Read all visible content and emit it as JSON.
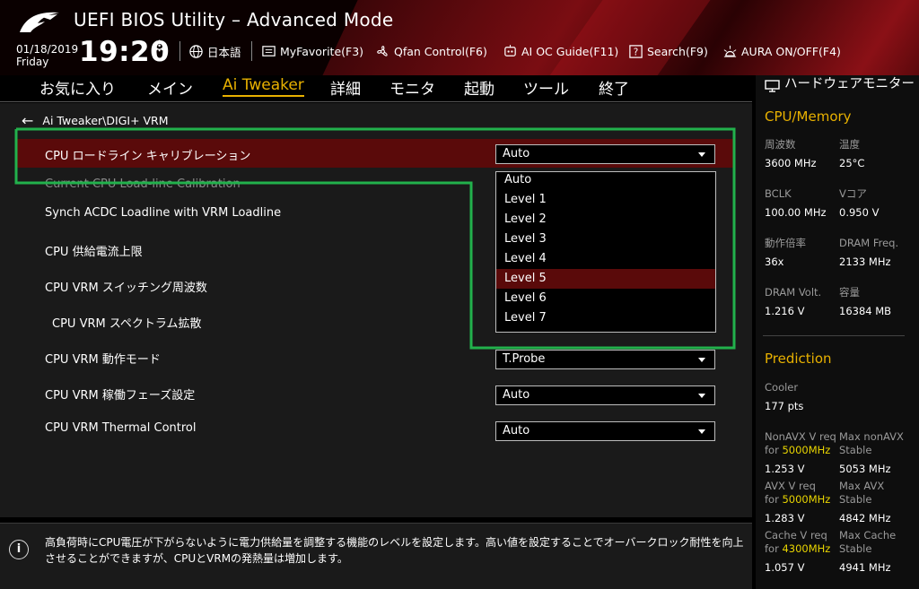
{
  "header": {
    "title": "UEFI BIOS Utility – Advanced Mode",
    "date": "01/18/2019",
    "day": "Friday",
    "time": "19:20",
    "tools": [
      {
        "label": "日本語",
        "icon": "globe-icon"
      },
      {
        "label": "MyFavorite(F3)",
        "icon": "favorite-icon"
      },
      {
        "label": "Qfan Control(F6)",
        "icon": "fan-icon"
      },
      {
        "label": "AI OC Guide(F11)",
        "icon": "ai-oc-guide-icon"
      },
      {
        "label": "Search(F9)",
        "icon": "search-icon"
      },
      {
        "label": "AURA ON/OFF(F4)",
        "icon": "aura-icon"
      }
    ]
  },
  "menu": {
    "items": [
      "お気に入り",
      "メイン",
      "Ai Tweaker",
      "詳細",
      "モニタ",
      "起動",
      "ツール",
      "終了"
    ],
    "active_index": 2
  },
  "breadcrumb": "Ai Tweaker\\DIGI+ VRM",
  "settings": [
    {
      "label": "CPU ロードライン キャリブレーション",
      "value": "Auto"
    },
    {
      "label": "Current CPU Load-line Calibration"
    },
    {
      "label": "Synch ACDC Loadline with VRM Loadline"
    },
    {
      "label": "CPU 供給電流上限"
    },
    {
      "label": "CPU VRM スイッチング周波数"
    },
    {
      "label": "CPU VRM スペクトラム拡散"
    },
    {
      "label": "CPU VRM 動作モード",
      "value": "T.Probe"
    },
    {
      "label": "CPU VRM 稼働フェーズ設定",
      "value": "Auto"
    },
    {
      "label": "CPU VRM Thermal Control",
      "value": "Auto"
    }
  ],
  "dropdown": {
    "options": [
      "Auto",
      "Level 1",
      "Level 2",
      "Level 3",
      "Level 4",
      "Level 5",
      "Level 6",
      "Level 7"
    ],
    "highlighted_index": 5
  },
  "help": {
    "text": "高負荷時にCPU電圧が下がらないように電力供給量を調整する機能のレベルを設定します。高い値を設定することでオーバークロック耐性を向上させることができますが、CPUとVRMの発熱量は増加します。"
  },
  "monitor": {
    "title": "ハードウェアモニター",
    "cpu_memory": {
      "heading": "CPU/Memory",
      "rows": [
        [
          {
            "label": "周波数",
            "value": "3600 MHz"
          },
          {
            "label": "温度",
            "value": "25°C"
          }
        ],
        [
          {
            "label": "BCLK",
            "value": "100.00 MHz"
          },
          {
            "label": "Vコア",
            "value": "0.950 V"
          }
        ],
        [
          {
            "label": "動作倍率",
            "value": "36x"
          },
          {
            "label": "DRAM Freq.",
            "value": "2133 MHz"
          }
        ],
        [
          {
            "label": "DRAM Volt.",
            "value": "1.216 V"
          },
          {
            "label": "容量",
            "value": "16384 MB"
          }
        ]
      ]
    },
    "prediction": {
      "heading": "Prediction",
      "cooler_label": "Cooler",
      "cooler_value": "177 pts",
      "rows": [
        {
          "l1": "NonAVX V req",
          "l2pre": "for ",
          "l2freq": "5000MHz",
          "lval": "1.253 V",
          "r1": "Max nonAVX",
          "r2": "Stable",
          "rval": "5053 MHz"
        },
        {
          "l1": "AVX V req",
          "l2pre": "for ",
          "l2freq": "5000MHz",
          "lval": "1.283 V",
          "r1": "Max AVX",
          "r2": "Stable",
          "rval": "4842 MHz"
        },
        {
          "l1": "Cache V req",
          "l2pre": "for ",
          "l2freq": "4300MHz",
          "lval": "1.057 V",
          "r1": "Max Cache",
          "r2": "Stable",
          "rval": "4941 MHz"
        }
      ]
    }
  },
  "colors": {
    "accent": "#e8b100",
    "selection": "#5a0a0a",
    "annotation_frame": "#22b14c"
  }
}
